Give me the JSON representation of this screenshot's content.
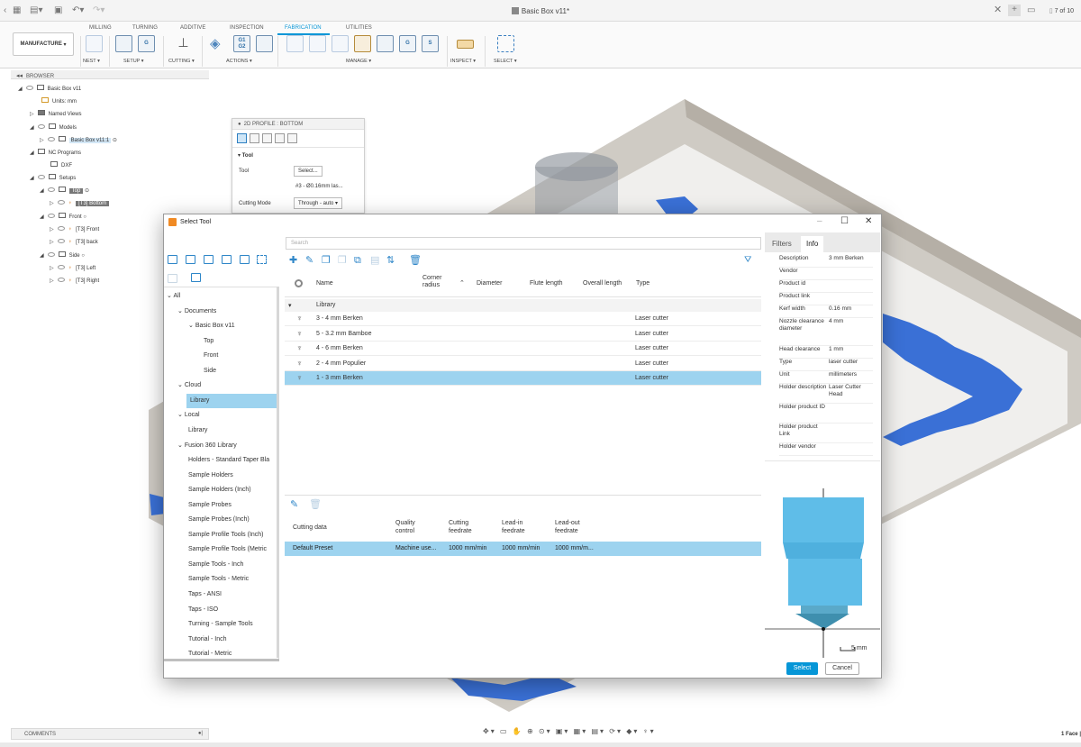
{
  "window": {
    "title": "Basic Box v11*",
    "tab_counter": "7 of 10"
  },
  "ribbon": {
    "workspace_button": "MANUFACTURE",
    "tabs": [
      "MILLING",
      "TURNING",
      "ADDITIVE",
      "INSPECTION",
      "FABRICATION",
      "UTILITIES"
    ],
    "active_tab": "FABRICATION",
    "groups": [
      "NEST ▾",
      "SETUP ▾",
      "CUTTING ▾",
      "ACTIONS ▾",
      "MANAGE ▾",
      "INSPECT ▾",
      "SELECT ▾"
    ],
    "g1_g2_label": "G1\nG2"
  },
  "browser": {
    "header": "BROWSER",
    "nodes": {
      "root": "Basic Box v11",
      "units": "Units: mm",
      "named_views": "Named Views",
      "models": "Models",
      "model_item": "Basic Box v11:1",
      "nc_programs": "NC Programs",
      "dxf": "DXF",
      "setups": "Setups",
      "top": "Top",
      "top_op": "[T3] Bottom",
      "front": "Front",
      "front_op1": "[T3] Front",
      "front_op2": "[T3] back",
      "side": "Side",
      "side_op1": "[T3] Left",
      "side_op2": "[T3] Right"
    }
  },
  "profile_panel": {
    "title": "2D PROFILE : BOTTOM",
    "section": "Tool",
    "tool_label": "Tool",
    "select_button": "Select...",
    "tool_value": "#3 - Ø0.16mm las...",
    "cutting_mode_label": "Cutting Mode",
    "cutting_mode_value": "Through - auto"
  },
  "dialog": {
    "title": "Select Tool",
    "search_placeholder": "Search",
    "tree": [
      {
        "label": "All",
        "chev": "⌄"
      },
      {
        "label": "Documents",
        "chev": "⌄"
      },
      {
        "label": "Basic Box v11",
        "chev": "⌄"
      },
      {
        "label": "Top",
        "chev": ""
      },
      {
        "label": "Front",
        "chev": ""
      },
      {
        "label": "Side",
        "chev": ""
      },
      {
        "label": "Cloud",
        "chev": "⌄"
      },
      {
        "label": "Library",
        "chev": ""
      },
      {
        "label": "Local",
        "chev": "⌄"
      },
      {
        "label": "Library",
        "chev": ""
      },
      {
        "label": "Fusion 360 Library",
        "chev": "⌄"
      },
      {
        "label": "Holders - Standard Taper Bla",
        "chev": ""
      },
      {
        "label": "Sample Holders",
        "chev": ""
      },
      {
        "label": "Sample Holders (Inch)",
        "chev": ""
      },
      {
        "label": "Sample Probes",
        "chev": ""
      },
      {
        "label": "Sample Probes (Inch)",
        "chev": ""
      },
      {
        "label": "Sample Profile Tools (Inch)",
        "chev": ""
      },
      {
        "label": "Sample Profile Tools (Metric",
        "chev": ""
      },
      {
        "label": "Sample Tools - Inch",
        "chev": ""
      },
      {
        "label": "Sample Tools - Metric",
        "chev": ""
      },
      {
        "label": "Taps - ANSI",
        "chev": ""
      },
      {
        "label": "Taps - ISO",
        "chev": ""
      },
      {
        "label": "Turning - Sample Tools",
        "chev": ""
      },
      {
        "label": "Tutorial - Inch",
        "chev": ""
      },
      {
        "label": "Tutorial - Metric",
        "chev": ""
      }
    ],
    "selected_tree_index": 7,
    "columns": {
      "name": "Name",
      "corner_radius": "Corner radius",
      "diameter": "Diameter",
      "flute_length": "Flute length",
      "overall_length": "Overall length",
      "type": "Type"
    },
    "group_label": "Library",
    "rows": [
      {
        "name": "3 - 4 mm Berken",
        "type": "Laser cutter"
      },
      {
        "name": "5 - 3.2 mm Bamboe",
        "type": "Laser cutter"
      },
      {
        "name": "4 - 6 mm Berken",
        "type": "Laser cutter"
      },
      {
        "name": "2 - 4 mm Populier",
        "type": "Laser cutter"
      },
      {
        "name": "1 - 3 mm Berken",
        "type": "Laser cutter"
      }
    ],
    "selected_row_index": 4,
    "cutting_columns": {
      "cutting_data": "Cutting data",
      "quality_control": "Quality control",
      "cutting_feedrate": "Cutting feedrate",
      "lead_in_feedrate": "Lead-in feedrate",
      "lead_out_feedrate": "Lead-out feedrate"
    },
    "cutting_row": {
      "name": "Default Preset",
      "quality": "Machine use...",
      "cutting": "1000 mm/min",
      "lead_in": "1000 mm/min",
      "lead_out": "1000 mm/m..."
    },
    "info_tabs": [
      "Filters",
      "Info"
    ],
    "active_info_tab": "Info",
    "info": [
      {
        "key": "Description",
        "value": "3 mm Berken"
      },
      {
        "key": "Vendor",
        "value": ""
      },
      {
        "key": "Product id",
        "value": ""
      },
      {
        "key": "Product link",
        "value": ""
      },
      {
        "key": "Kerf width",
        "value": "0.16 mm"
      },
      {
        "key": "Nozzle clearance diameter",
        "value": "4 mm"
      },
      {
        "key": "Head clearance",
        "value": "1 mm"
      },
      {
        "key": "Type",
        "value": "laser cutter"
      },
      {
        "key": "Unit",
        "value": "millimeters"
      },
      {
        "key": "Holder description",
        "value": "Laser Cutter Head"
      },
      {
        "key": "Holder product ID",
        "value": ""
      },
      {
        "key": "Holder product Link",
        "value": ""
      },
      {
        "key": "Holder vendor",
        "value": ""
      }
    ],
    "scale_label": "5 mm",
    "select_button": "Select",
    "cancel_button": "Cancel"
  },
  "status": {
    "comments": "COMMENTS",
    "selection": "1 Face |"
  },
  "colors": {
    "accent": "#0696d7",
    "selection": "#9dd3ef",
    "model_wall": "#c7c2ba",
    "model_floor": "#3a70d6",
    "tool_preview": "#5fbde8"
  }
}
